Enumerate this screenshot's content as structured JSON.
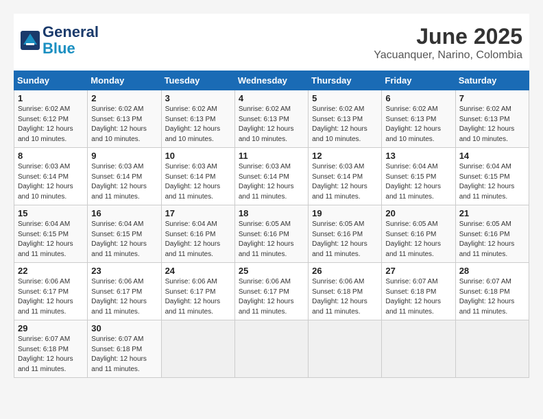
{
  "header": {
    "logo_line1": "General",
    "logo_line2": "Blue",
    "month_title": "June 2025",
    "subtitle": "Yacuanquer, Narino, Colombia"
  },
  "weekdays": [
    "Sunday",
    "Monday",
    "Tuesday",
    "Wednesday",
    "Thursday",
    "Friday",
    "Saturday"
  ],
  "weeks": [
    [
      {
        "day": "1",
        "sunrise": "6:02 AM",
        "sunset": "6:12 PM",
        "daylight": "12 hours and 10 minutes."
      },
      {
        "day": "2",
        "sunrise": "6:02 AM",
        "sunset": "6:13 PM",
        "daylight": "12 hours and 10 minutes."
      },
      {
        "day": "3",
        "sunrise": "6:02 AM",
        "sunset": "6:13 PM",
        "daylight": "12 hours and 10 minutes."
      },
      {
        "day": "4",
        "sunrise": "6:02 AM",
        "sunset": "6:13 PM",
        "daylight": "12 hours and 10 minutes."
      },
      {
        "day": "5",
        "sunrise": "6:02 AM",
        "sunset": "6:13 PM",
        "daylight": "12 hours and 10 minutes."
      },
      {
        "day": "6",
        "sunrise": "6:02 AM",
        "sunset": "6:13 PM",
        "daylight": "12 hours and 10 minutes."
      },
      {
        "day": "7",
        "sunrise": "6:02 AM",
        "sunset": "6:13 PM",
        "daylight": "12 hours and 10 minutes."
      }
    ],
    [
      {
        "day": "8",
        "sunrise": "6:03 AM",
        "sunset": "6:14 PM",
        "daylight": "12 hours and 10 minutes."
      },
      {
        "day": "9",
        "sunrise": "6:03 AM",
        "sunset": "6:14 PM",
        "daylight": "12 hours and 11 minutes."
      },
      {
        "day": "10",
        "sunrise": "6:03 AM",
        "sunset": "6:14 PM",
        "daylight": "12 hours and 11 minutes."
      },
      {
        "day": "11",
        "sunrise": "6:03 AM",
        "sunset": "6:14 PM",
        "daylight": "12 hours and 11 minutes."
      },
      {
        "day": "12",
        "sunrise": "6:03 AM",
        "sunset": "6:14 PM",
        "daylight": "12 hours and 11 minutes."
      },
      {
        "day": "13",
        "sunrise": "6:04 AM",
        "sunset": "6:15 PM",
        "daylight": "12 hours and 11 minutes."
      },
      {
        "day": "14",
        "sunrise": "6:04 AM",
        "sunset": "6:15 PM",
        "daylight": "12 hours and 11 minutes."
      }
    ],
    [
      {
        "day": "15",
        "sunrise": "6:04 AM",
        "sunset": "6:15 PM",
        "daylight": "12 hours and 11 minutes."
      },
      {
        "day": "16",
        "sunrise": "6:04 AM",
        "sunset": "6:15 PM",
        "daylight": "12 hours and 11 minutes."
      },
      {
        "day": "17",
        "sunrise": "6:04 AM",
        "sunset": "6:16 PM",
        "daylight": "12 hours and 11 minutes."
      },
      {
        "day": "18",
        "sunrise": "6:05 AM",
        "sunset": "6:16 PM",
        "daylight": "12 hours and 11 minutes."
      },
      {
        "day": "19",
        "sunrise": "6:05 AM",
        "sunset": "6:16 PM",
        "daylight": "12 hours and 11 minutes."
      },
      {
        "day": "20",
        "sunrise": "6:05 AM",
        "sunset": "6:16 PM",
        "daylight": "12 hours and 11 minutes."
      },
      {
        "day": "21",
        "sunrise": "6:05 AM",
        "sunset": "6:16 PM",
        "daylight": "12 hours and 11 minutes."
      }
    ],
    [
      {
        "day": "22",
        "sunrise": "6:06 AM",
        "sunset": "6:17 PM",
        "daylight": "12 hours and 11 minutes."
      },
      {
        "day": "23",
        "sunrise": "6:06 AM",
        "sunset": "6:17 PM",
        "daylight": "12 hours and 11 minutes."
      },
      {
        "day": "24",
        "sunrise": "6:06 AM",
        "sunset": "6:17 PM",
        "daylight": "12 hours and 11 minutes."
      },
      {
        "day": "25",
        "sunrise": "6:06 AM",
        "sunset": "6:17 PM",
        "daylight": "12 hours and 11 minutes."
      },
      {
        "day": "26",
        "sunrise": "6:06 AM",
        "sunset": "6:18 PM",
        "daylight": "12 hours and 11 minutes."
      },
      {
        "day": "27",
        "sunrise": "6:07 AM",
        "sunset": "6:18 PM",
        "daylight": "12 hours and 11 minutes."
      },
      {
        "day": "28",
        "sunrise": "6:07 AM",
        "sunset": "6:18 PM",
        "daylight": "12 hours and 11 minutes."
      }
    ],
    [
      {
        "day": "29",
        "sunrise": "6:07 AM",
        "sunset": "6:18 PM",
        "daylight": "12 hours and 11 minutes."
      },
      {
        "day": "30",
        "sunrise": "6:07 AM",
        "sunset": "6:18 PM",
        "daylight": "12 hours and 11 minutes."
      },
      null,
      null,
      null,
      null,
      null
    ]
  ]
}
